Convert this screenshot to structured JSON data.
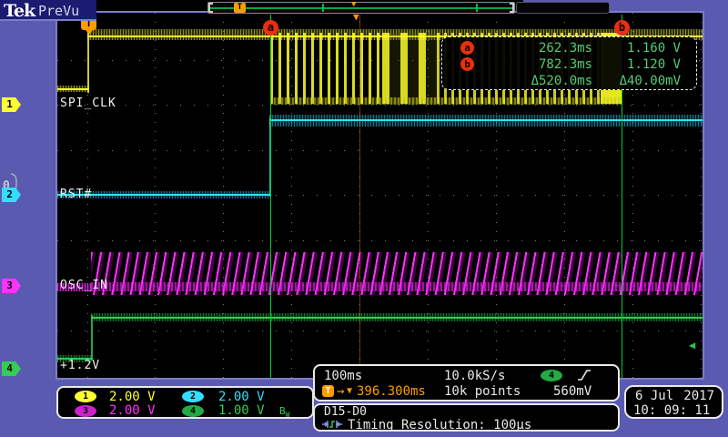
{
  "header": {
    "logo": "Tek",
    "mode": "PreVu"
  },
  "cursors": {
    "a_label": "a",
    "b_label": "b",
    "a_time": "262.3ms",
    "a_value": "1.160 V",
    "b_time": "782.3ms",
    "b_value": "1.120 V",
    "delta_time": "Δ520.0ms",
    "delta_value": "Δ40.00mV"
  },
  "channels": [
    {
      "num": "1",
      "name": "SPI_CLK",
      "scale": "2.00 V"
    },
    {
      "num": "2",
      "name": "RST#",
      "scale": "2.00 V"
    },
    {
      "num": "3",
      "name": "OSC_IN",
      "scale": "2.00 V"
    },
    {
      "num": "4",
      "name": "+1.2V",
      "scale": "1.00 V"
    }
  ],
  "digital_group": {
    "marker": "0",
    "bus": "D15-D0",
    "resolution": "Timing Resolution: 100μs"
  },
  "bw_limit": {
    "main": "B",
    "sub": "W"
  },
  "horizontal": {
    "scale": "100ms",
    "sample_rate": "10.0kS/s",
    "record": "10k points",
    "delay": "396.300ms"
  },
  "trigger": {
    "marker": "T",
    "source": "4",
    "level": "560mV"
  },
  "datetime": {
    "date_left": "6 Jul",
    "date_right": "2017",
    "time": "10: 09: 11"
  },
  "icons": {
    "arrow_right": "→",
    "triangle_down": "▼",
    "level_arrow": "◀"
  },
  "colors": {
    "ch1": "#ffff33",
    "ch2": "#33dfff",
    "ch3": "#ff33ff",
    "ch4": "#33cc55",
    "cursor_green": "#00cc33",
    "accent_orange": "#ff9d00",
    "readout_green": "#55cc77"
  }
}
